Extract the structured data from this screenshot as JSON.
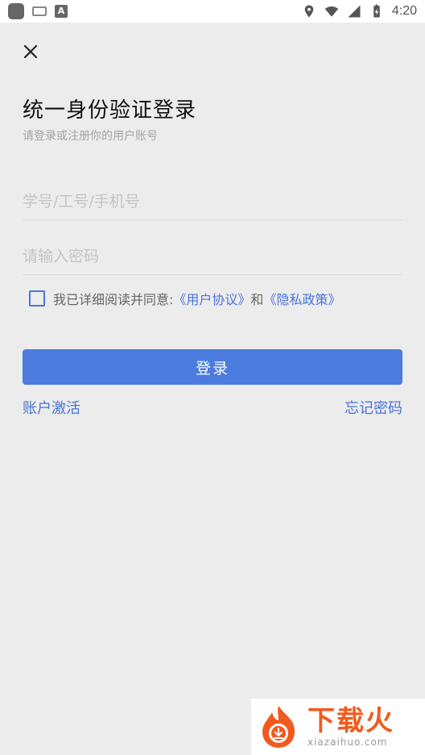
{
  "status_bar": {
    "time": "4:20",
    "icons": [
      "app-icon",
      "keyboard-icon",
      "a-icon",
      "location-icon",
      "wifi-icon",
      "signal-icon",
      "battery-icon"
    ]
  },
  "header": {
    "close_icon": "close-icon",
    "title": "统一身份验证登录",
    "subtitle": "请登录或注册你的用户账号"
  },
  "form": {
    "username_placeholder": "学号/工号/手机号",
    "username_value": "",
    "password_placeholder": "请输入密码",
    "password_value": "",
    "agree_text": "我已详细阅读并同意:",
    "user_agreement": "《用户协议》",
    "and_text": "和",
    "privacy_policy": "《隐私政策》",
    "agree_checked": false,
    "login_label": "登录",
    "activate_label": "账户激活",
    "forgot_label": "忘记密码"
  },
  "watermark": {
    "brand_cn": "下载火",
    "brand_en": "xiazaihuo.com"
  },
  "colors": {
    "accent": "#4b7bdf",
    "link": "#4a74d8",
    "background": "#ececec",
    "brand": "#f25a1d"
  }
}
